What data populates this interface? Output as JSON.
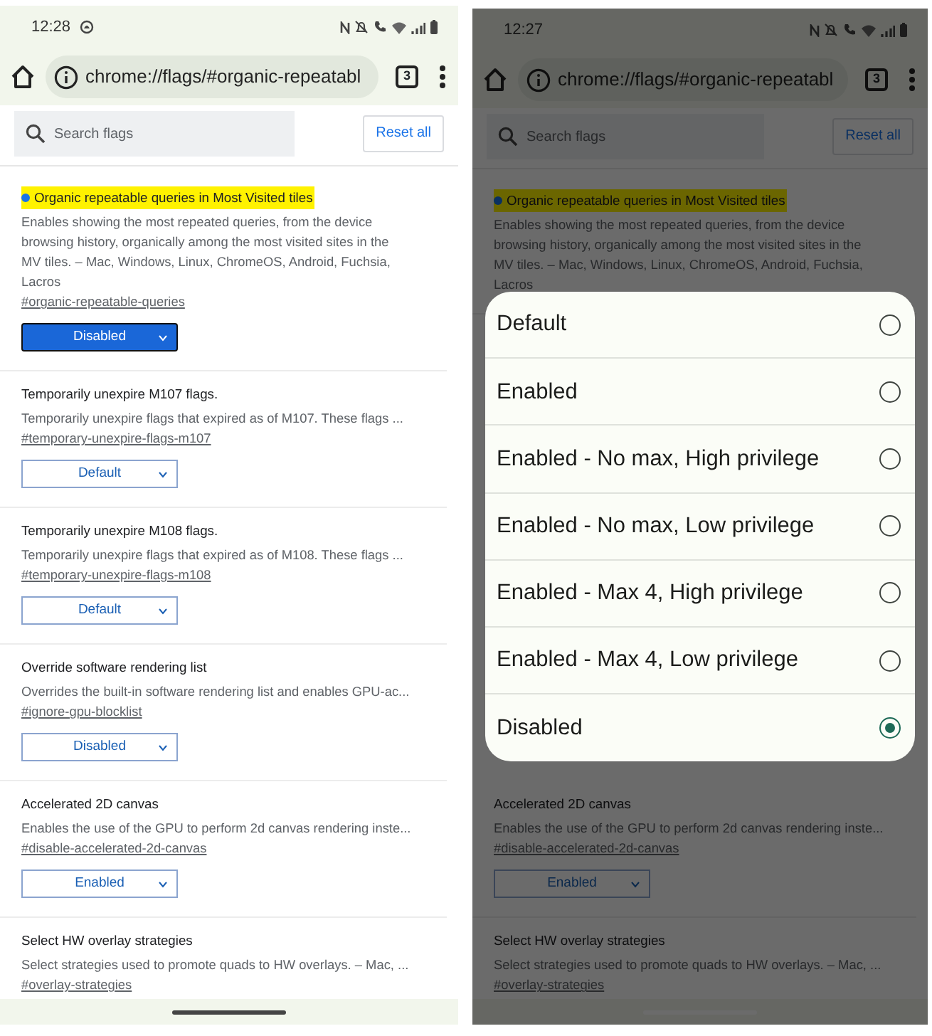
{
  "screens": [
    {
      "dimmed": false,
      "status_bar": {
        "time": "12:28",
        "extra_icon": true
      },
      "toolbar": {
        "url": "chrome://flags/#organic-repeatabl",
        "tab_count": "3"
      },
      "search": {
        "placeholder": "Search flags",
        "reset": "Reset all"
      },
      "flags": [
        {
          "title": "Organic repeatable queries in Most Visited tiles",
          "highlighted": true,
          "description": "Enables showing the most repeated queries, from the device browsing history, organically among the most visited sites in the MV tiles. – Mac, Windows, Linux, ChromeOS, Android, Fuchsia, Lacros",
          "link": "#organic-repeatable-queries",
          "select": {
            "value": "Disabled",
            "focused": true
          }
        },
        {
          "title": "Temporarily unexpire M107 flags.",
          "highlighted": false,
          "description": "Temporarily unexpire flags that expired as of M107. These flags ...",
          "link": "#temporary-unexpire-flags-m107",
          "select": {
            "value": "Default",
            "focused": false
          }
        },
        {
          "title": "Temporarily unexpire M108 flags.",
          "highlighted": false,
          "description": "Temporarily unexpire flags that expired as of M108. These flags ...",
          "link": "#temporary-unexpire-flags-m108",
          "select": {
            "value": "Default",
            "focused": false
          }
        },
        {
          "title": "Override software rendering list",
          "highlighted": false,
          "description": "Overrides the built-in software rendering list and enables GPU-ac...",
          "link": "#ignore-gpu-blocklist",
          "select": {
            "value": "Disabled",
            "focused": false
          }
        },
        {
          "title": "Accelerated 2D canvas",
          "highlighted": false,
          "description": "Enables the use of the GPU to perform 2d canvas rendering inste...",
          "link": "#disable-accelerated-2d-canvas",
          "select": {
            "value": "Enabled",
            "focused": false
          }
        },
        {
          "title": "Select HW overlay strategies",
          "highlighted": false,
          "description": "Select strategies used to promote quads to HW overlays. – Mac, ...",
          "link": "#overlay-strategies"
        }
      ]
    },
    {
      "dimmed": true,
      "status_bar": {
        "time": "12:27",
        "extra_icon": false
      },
      "toolbar": {
        "url": "chrome://flags/#organic-repeatabl",
        "tab_count": "3"
      },
      "search": {
        "placeholder": "Search flags",
        "reset": "Reset all"
      },
      "flags": [
        {
          "title": "Organic repeatable queries in Most Visited tiles",
          "highlighted": true,
          "description": "Enables showing the most repeated queries, from the device browsing history, organically among the most visited sites in the MV tiles. – Mac, Windows, Linux, ChromeOS, Android, Fuchsia, Lacros"
        }
      ],
      "dialog": {
        "options": [
          {
            "label": "Default",
            "selected": false
          },
          {
            "label": "Enabled",
            "selected": false
          },
          {
            "label": "Enabled - No max, High privilege",
            "selected": false
          },
          {
            "label": "Enabled - No max, Low privilege",
            "selected": false
          },
          {
            "label": "Enabled - Max 4, High privilege",
            "selected": false
          },
          {
            "label": "Enabled - Max 4, Low privilege",
            "selected": false
          },
          {
            "label": "Disabled",
            "selected": true
          }
        ]
      },
      "flags_below": [
        {
          "title": "Accelerated 2D canvas",
          "highlighted": false,
          "description": "Enables the use of the GPU to perform 2d canvas rendering inste...",
          "link": "#disable-accelerated-2d-canvas",
          "select": {
            "value": "Enabled",
            "focused": false
          }
        },
        {
          "title": "Select HW overlay strategies",
          "highlighted": false,
          "description": "Select strategies used to promote quads to HW overlays. – Mac, ...",
          "link": "#overlay-strategies"
        }
      ]
    }
  ]
}
